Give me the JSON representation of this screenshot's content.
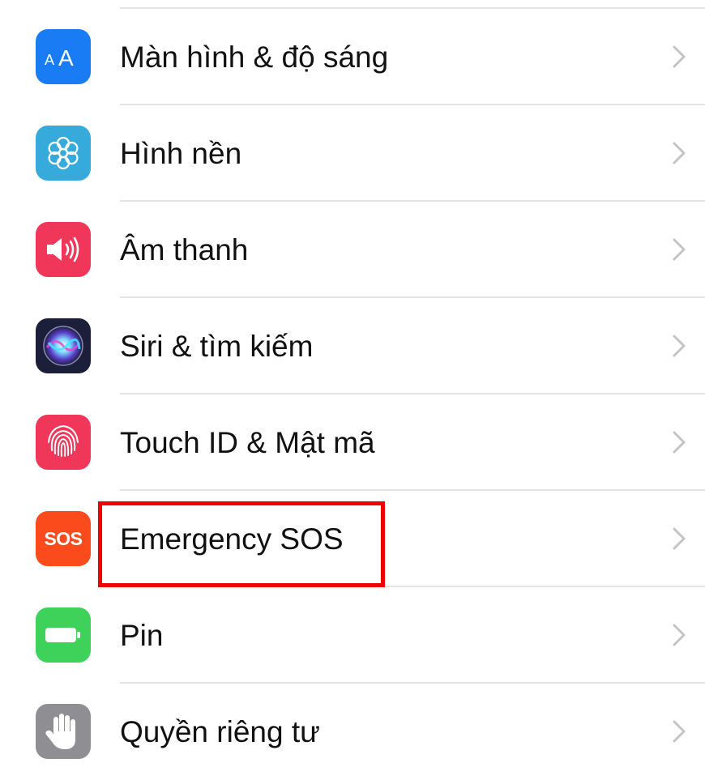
{
  "settings": {
    "items": [
      {
        "label": "Màn hình & độ sáng",
        "icon": "display-brightness-icon",
        "color": "#1a7cf5"
      },
      {
        "label": "Hình nền",
        "icon": "wallpaper-flower-icon",
        "color": "#37aadc"
      },
      {
        "label": "Âm thanh",
        "icon": "speaker-icon",
        "color": "#f0375a"
      },
      {
        "label": "Siri & tìm kiếm",
        "icon": "siri-icon",
        "color": "#1b1f3a"
      },
      {
        "label": "Touch ID & Mật mã",
        "icon": "fingerprint-icon",
        "color": "#f0375a"
      },
      {
        "label": "Emergency SOS",
        "icon": "sos-icon",
        "icon_text": "SOS",
        "color": "#fb4a1b",
        "highlighted": true
      },
      {
        "label": "Pin",
        "icon": "battery-icon",
        "color": "#3fd25b"
      },
      {
        "label": "Quyền riêng tư",
        "icon": "hand-privacy-icon",
        "color": "#8e8e93"
      }
    ]
  },
  "colors": {
    "highlight_border": "#ee0000",
    "chevron": "#c4c4c7",
    "divider": "#e3e3e6"
  }
}
